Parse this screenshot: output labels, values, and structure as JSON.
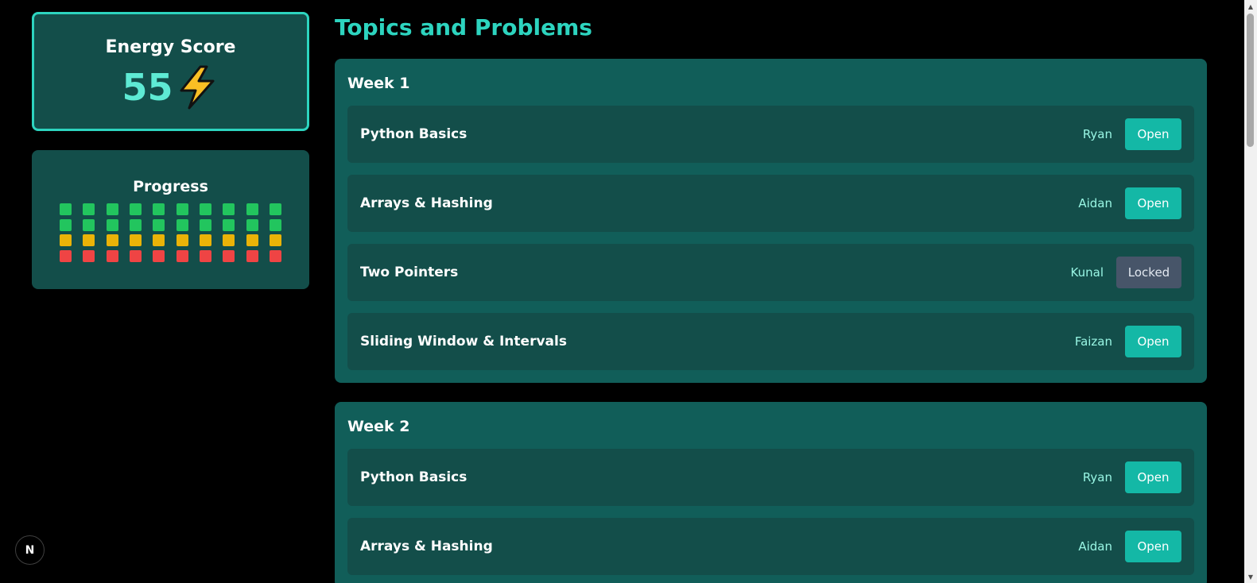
{
  "energy": {
    "title": "Energy Score",
    "value": "55",
    "icon": "lightning-bolt-icon"
  },
  "progress": {
    "title": "Progress",
    "columns": 10,
    "rows": [
      {
        "status": "green",
        "color": "#22c55e"
      },
      {
        "status": "green",
        "color": "#22c55e"
      },
      {
        "status": "yellow",
        "color": "#eab308"
      },
      {
        "status": "red",
        "color": "#ef4444"
      }
    ]
  },
  "main": {
    "title": "Topics and Problems",
    "weeks": [
      {
        "title": "Week 1",
        "topics": [
          {
            "name": "Python Basics",
            "owner": "Ryan",
            "button": "Open",
            "locked": false
          },
          {
            "name": "Arrays & Hashing",
            "owner": "Aidan",
            "button": "Open",
            "locked": false
          },
          {
            "name": "Two Pointers",
            "owner": "Kunal",
            "button": "Locked",
            "locked": true
          },
          {
            "name": "Sliding Window & Intervals",
            "owner": "Faizan",
            "button": "Open",
            "locked": false
          }
        ]
      },
      {
        "title": "Week 2",
        "topics": [
          {
            "name": "Python Basics",
            "owner": "Ryan",
            "button": "Open",
            "locked": false
          },
          {
            "name": "Arrays & Hashing",
            "owner": "Aidan",
            "button": "Open",
            "locked": false
          }
        ]
      }
    ]
  },
  "dev_badge": {
    "label": "N",
    "icon": "nextjs-icon"
  },
  "colors": {
    "accent": "#2dd4bf",
    "card": "#134e4a",
    "week_card": "#115e59",
    "open_button": "#14b8a6",
    "locked_button": "#475569"
  }
}
